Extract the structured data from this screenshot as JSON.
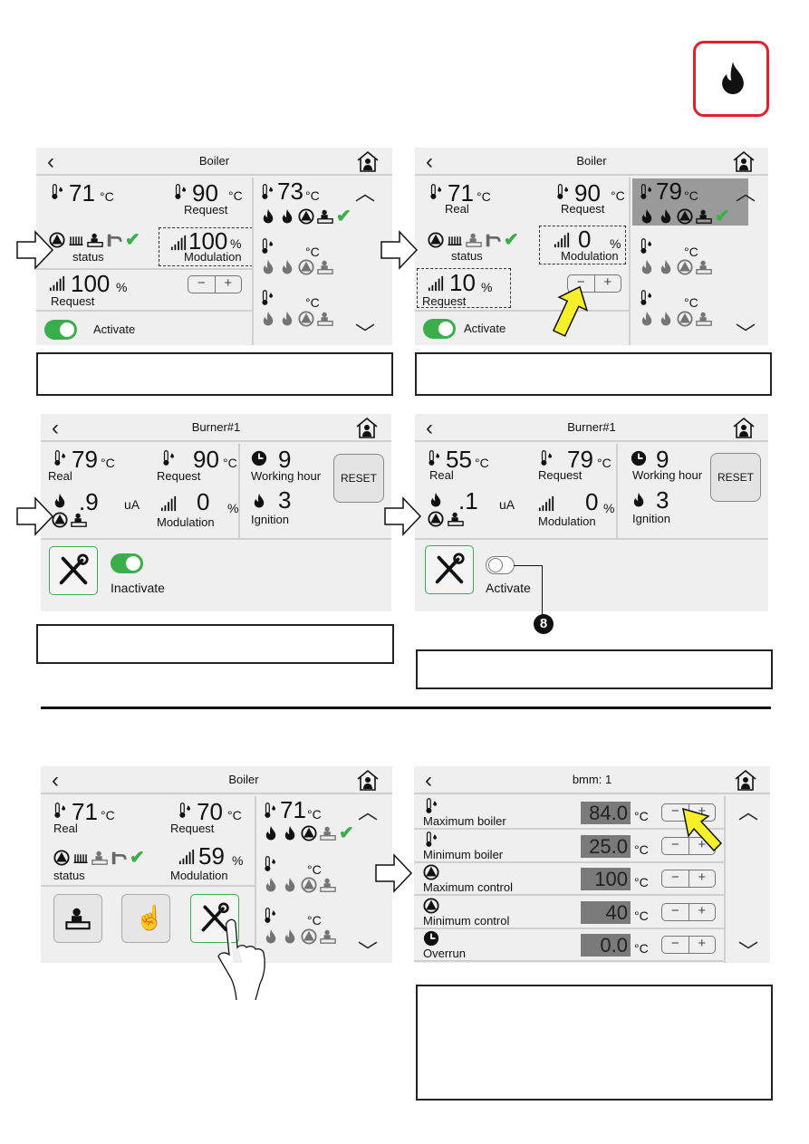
{
  "colors": {
    "accent_green": "#3aae4a",
    "flame_badge_border": "#e0202a",
    "highlight_arrow": "#f5f02a"
  },
  "icons": [
    "flame-badge-icon",
    "thermometer-icon",
    "pump-icon",
    "radiator-icon",
    "chimney-sweep-icon",
    "tap-icon",
    "check-icon",
    "signal-bars-icon",
    "clock-icon",
    "tools-icon",
    "hand-icon",
    "home-icon"
  ],
  "panel1": {
    "title": "Boiler",
    "temp": "71",
    "temp_unit": "°C",
    "request": "90",
    "request_unit": "°C",
    "request_label": "Request",
    "status_label": "status",
    "modulation": "100",
    "modulation_unit": "%",
    "modulation_label": "Modulation",
    "req_pct": "100",
    "req_pct_unit": "%",
    "req_pct_label": "Request",
    "minus": "−",
    "plus": "+",
    "activate": "Activate",
    "side": [
      {
        "temp": "73",
        "unit": "°C",
        "index": "1"
      },
      {
        "temp": "",
        "unit": "°C",
        "index": "2"
      },
      {
        "temp": "",
        "unit": "°C",
        "index": "3"
      }
    ]
  },
  "panel2": {
    "title": "Boiler",
    "temp": "71",
    "temp_unit": "°C",
    "real_label": "Real",
    "request": "90",
    "request_unit": "°C",
    "request_label": "Request",
    "status_label": "status",
    "modulation": "0",
    "modulation_unit": "%",
    "modulation_label": "Modulation",
    "req_pct": "10",
    "req_pct_unit": "%",
    "req_pct_label": "Request",
    "minus": "−",
    "plus": "+",
    "activate": "Activate",
    "side": [
      {
        "temp": "79",
        "unit": "°C",
        "index": "1"
      },
      {
        "temp": "",
        "unit": "°C",
        "index": "2"
      },
      {
        "temp": "",
        "unit": "°C",
        "index": "3"
      }
    ]
  },
  "panel3": {
    "title": "Burner#1",
    "real": "79",
    "real_unit": "°C",
    "real_label": "Real",
    "request": "90",
    "request_unit": "°C",
    "request_label": "Request",
    "hours": "9",
    "hours_label": "Working hour",
    "reset": "RESET",
    "current": ".9",
    "current_unit": "uA",
    "modulation": "0",
    "modulation_unit": "%",
    "modulation_label": "Modulation",
    "ignition": "3",
    "ignition_label": "Ignition",
    "toggle_label": "Inactivate"
  },
  "panel4": {
    "title": "Burner#1",
    "real": "55",
    "real_unit": "°C",
    "real_label": "Real",
    "request": "79",
    "request_unit": "°C",
    "request_label": "Request",
    "hours": "9",
    "hours_label": "Working hour",
    "reset": "RESET",
    "current": ".1",
    "current_unit": "uA",
    "modulation": "0",
    "modulation_unit": "%",
    "modulation_label": "Modulation",
    "ignition": "3",
    "ignition_label": "Ignition",
    "toggle_label": "Activate",
    "callout": "8"
  },
  "panel5": {
    "title": "Boiler",
    "temp": "71",
    "temp_unit": "°C",
    "real_label": "Real",
    "request": "70",
    "request_unit": "°C",
    "request_label": "Request",
    "status_label": "status",
    "modulation": "59",
    "modulation_unit": "%",
    "modulation_label": "Modulation",
    "side": [
      {
        "temp": "71",
        "unit": "°C",
        "index": "1"
      },
      {
        "temp": "",
        "unit": "°C",
        "index": "2"
      },
      {
        "temp": "",
        "unit": "°C",
        "index": "3"
      }
    ]
  },
  "panel6": {
    "title": "bmm: 1",
    "rows": [
      {
        "label": "Maximum boiler",
        "value": "84.0",
        "unit": "°C"
      },
      {
        "label": "Minimum boiler",
        "value": "25.0",
        "unit": "°C"
      },
      {
        "label": "Maximum control",
        "value": "100",
        "unit": "°C"
      },
      {
        "label": "Minimum control",
        "value": "40",
        "unit": "°C"
      },
      {
        "label": "Overrun",
        "value": "0.0",
        "unit": "°C"
      }
    ],
    "minus": "−",
    "plus": "+"
  }
}
